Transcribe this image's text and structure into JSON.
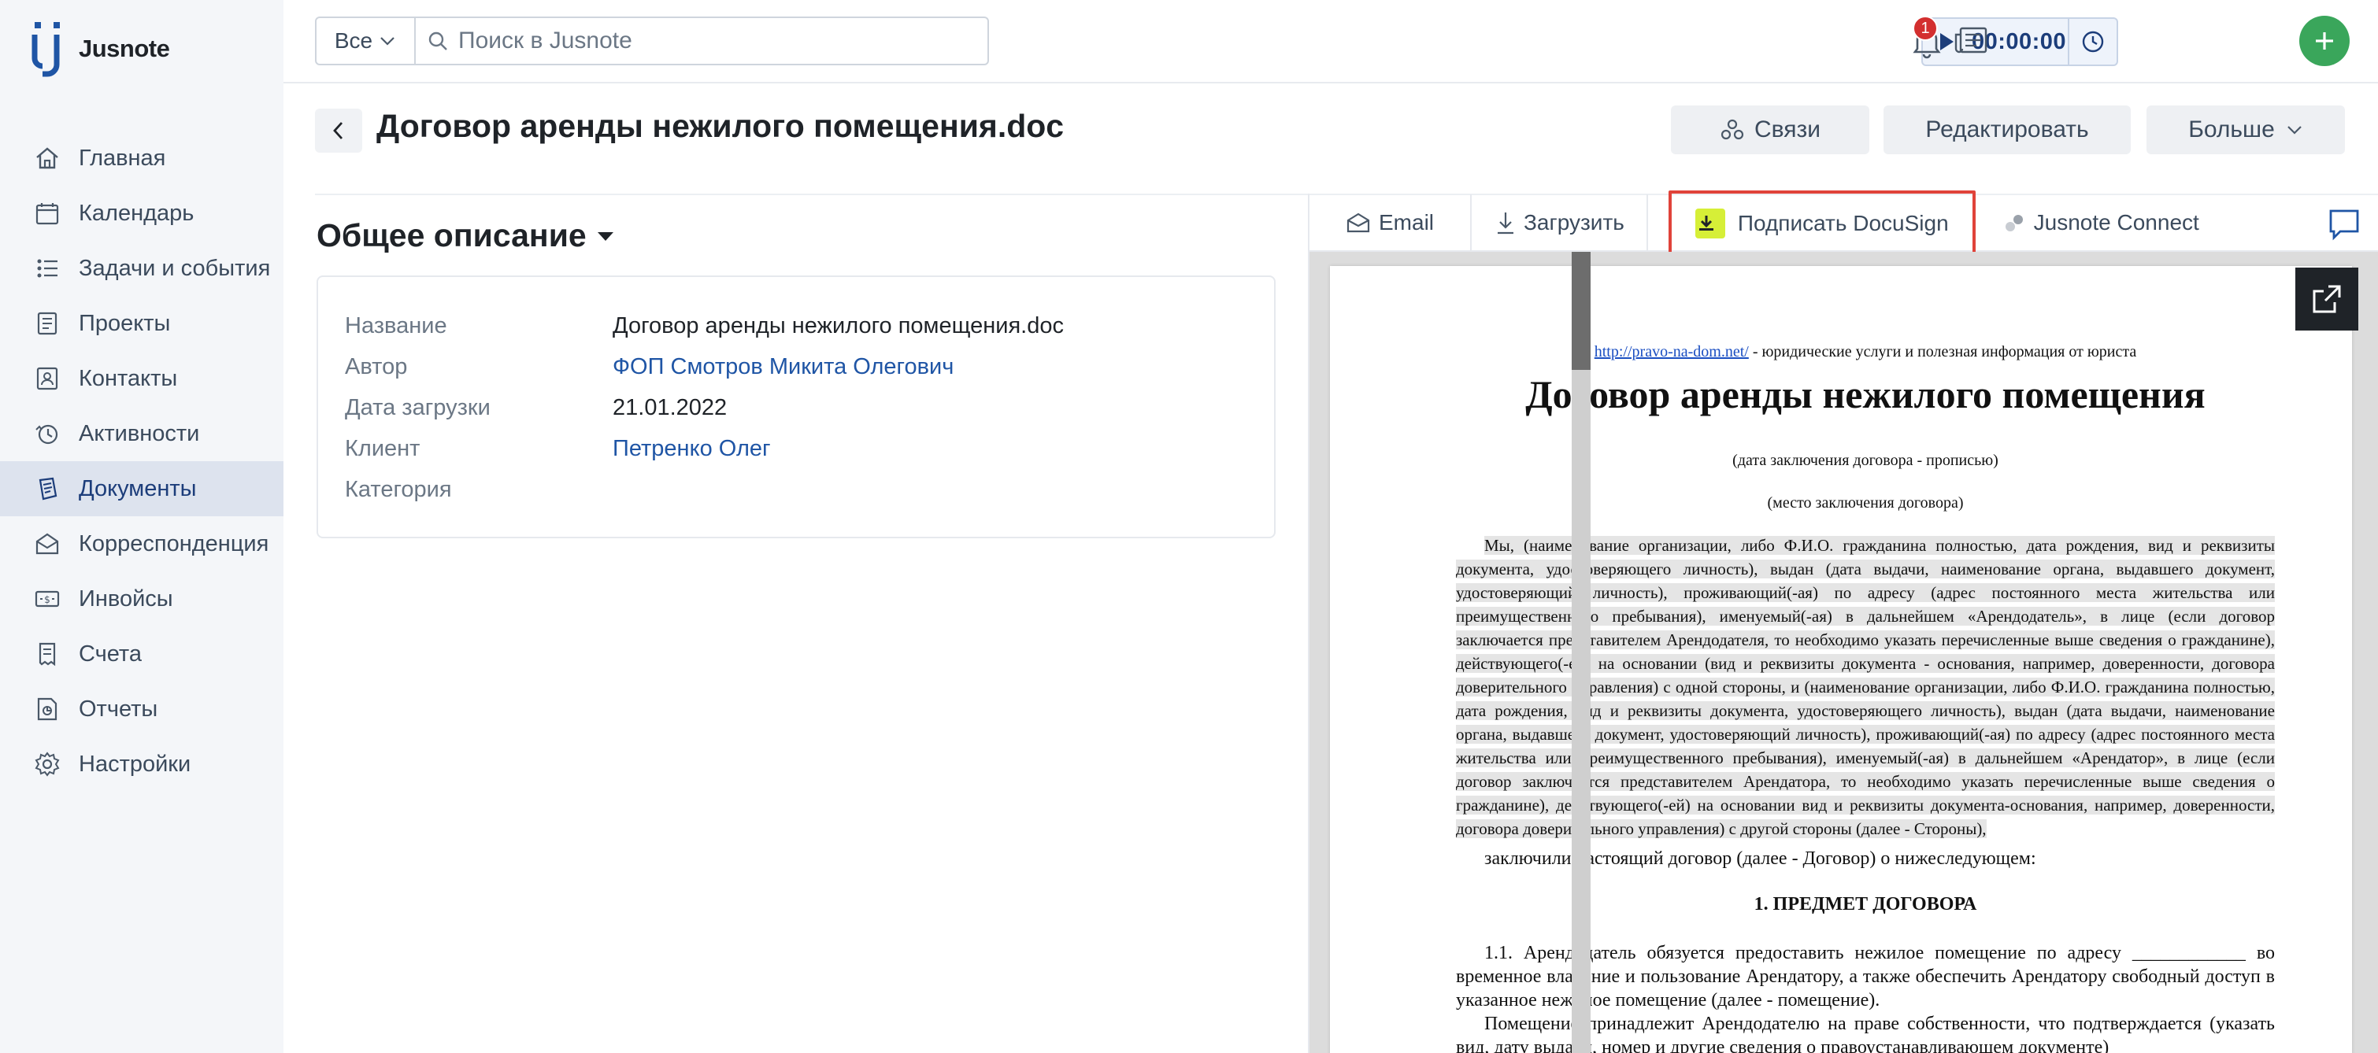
{
  "app": {
    "name": "Jusnote"
  },
  "sidebar": {
    "items": [
      {
        "label": "Главная",
        "icon": "home-icon"
      },
      {
        "label": "Календарь",
        "icon": "calendar-icon"
      },
      {
        "label": "Задачи и события",
        "icon": "tasks-icon"
      },
      {
        "label": "Проекты",
        "icon": "projects-icon"
      },
      {
        "label": "Контакты",
        "icon": "contacts-icon"
      },
      {
        "label": "Активности",
        "icon": "activity-icon"
      },
      {
        "label": "Документы",
        "icon": "documents-icon",
        "active": true
      },
      {
        "label": "Корреспонденция",
        "icon": "mail-icon"
      },
      {
        "label": "Инвойсы",
        "icon": "invoice-icon"
      },
      {
        "label": "Счета",
        "icon": "accounts-icon"
      },
      {
        "label": "Отчеты",
        "icon": "reports-icon"
      },
      {
        "label": "Настройки",
        "icon": "settings-icon"
      }
    ]
  },
  "topbar": {
    "scope": "Все",
    "search_placeholder": "Поиск в Jusnote",
    "timer": "00:00:00",
    "notifications_count": "1",
    "accent": "#3aa65b"
  },
  "header": {
    "title": "Договор аренды нежилого помещения.doc",
    "links_label": "Связи",
    "edit_label": "Редактировать",
    "more_label": "Больше"
  },
  "details": {
    "section_title": "Общее описание",
    "rows": [
      {
        "key": "Название",
        "value": "Договор аренды нежилого помещения.doc"
      },
      {
        "key": "Автор",
        "value": "ФОП Смотров Микита Олегович",
        "link": true
      },
      {
        "key": "Дата загрузки",
        "value": "21.01.2022"
      },
      {
        "key": "Клиент",
        "value": "Петренко Олег",
        "link": true
      },
      {
        "key": "Категория",
        "value": ""
      }
    ]
  },
  "preview_tabs": {
    "email": "Email",
    "download": "Загрузить",
    "docusign": "Подписать DocuSign",
    "connect": "Jusnote Connect",
    "highlight_color": "#e0433a"
  },
  "document": {
    "source_link": "http://pravo-na-dom.net/",
    "source_text": " -  юридические услуги и полезная информация от юриста",
    "title": "Договор аренды нежилого помещения",
    "sub1": "(дата заключения договора - прописью)",
    "sub2": "(место заключения договора)",
    "para1": "Мы, (наименование организации, либо Ф.И.О. гражданина полностью, дата рождения, вид и реквизиты документа, удостоверяющего личность), выдан (дата выдачи, наименование органа, выдавшего документ, удостоверяющий личность), проживающий(-ая) по адресу (адрес постоянного места жительства или преимущественного пребывания), именуемый(-ая) в дальнейшем «Арендодатель», в лице (если договор заключается представителем Арендодателя, то необходимо указать перечисленные выше сведения о гражданине), действующего(-ей) на основании (вид и реквизиты документа - основания, например, доверенности, договора доверительного управления) с одной стороны, и (наименование организации, либо Ф.И.О. гражданина полностью, дата рождения, вид и реквизиты документа, удостоверяющего личность), выдан (дата выдачи, наименование органа, выдавшего документ, удостоверяющий личность), проживающий(-ая) по адресу (адрес постоянного места жительства или преимущественного пребывания), именуемый(-ая) в дальнейшем «Арендатор», в лице (если договор заключается представителем Арендатора, то необходимо указать перечисленные выше сведения о гражданине), действующего(-ей) на основании вид и реквизиты документа-основания, например, доверенности, договора доверительного управления) с другой стороны (далее - Стороны),",
    "para2": "заключили настоящий договор (далее - Договор) о нижеследующем:",
    "section1": "1. ПРЕДМЕТ ДОГОВОРА",
    "clause1": "1.1. Арендодатель обязуется предоставить нежилое помещение по адресу ____________ во временное владение и пользование Арендатору, а также обеспечить Арендатору свободный доступ в указанное нежилое помещение (далее - помещение).",
    "clause2": "Помещение принадлежит Арендодателю на праве собственности, что подтверждается (указать вид, дату выдачи, номер и другие сведения о правоустанавливающем документе)"
  }
}
